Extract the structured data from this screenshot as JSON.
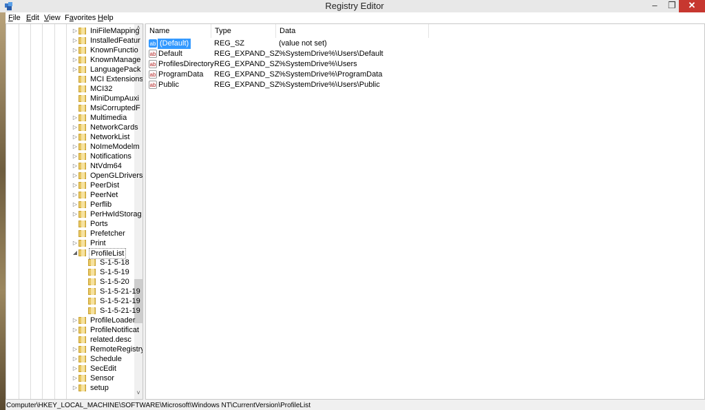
{
  "window": {
    "title": "Registry Editor",
    "minimize": "–",
    "maximize": "❐",
    "close": "✕",
    "app_icon": "regedit-icon"
  },
  "menu": [
    {
      "pre": "",
      "ul": "F",
      "post": "ile"
    },
    {
      "pre": "",
      "ul": "E",
      "post": "dit"
    },
    {
      "pre": "",
      "ul": "V",
      "post": "iew"
    },
    {
      "pre": "F",
      "ul": "a",
      "post": "vorites"
    },
    {
      "pre": "",
      "ul": "H",
      "post": "elp"
    }
  ],
  "tree": {
    "nodes": [
      {
        "label": "IniFileMapping",
        "expander": "▷"
      },
      {
        "label": "InstalledFeatur",
        "expander": "▷"
      },
      {
        "label": "KnownFunctio",
        "expander": "▷"
      },
      {
        "label": "KnownManage",
        "expander": "▷"
      },
      {
        "label": "LanguagePack",
        "expander": "▷"
      },
      {
        "label": "MCI Extensions",
        "expander": ""
      },
      {
        "label": "MCI32",
        "expander": ""
      },
      {
        "label": "MiniDumpAuxi",
        "expander": ""
      },
      {
        "label": "MsiCorruptedF",
        "expander": ""
      },
      {
        "label": "Multimedia",
        "expander": "▷"
      },
      {
        "label": "NetworkCards",
        "expander": "▷"
      },
      {
        "label": "NetworkList",
        "expander": "▷"
      },
      {
        "label": "NoImeModelm",
        "expander": "▷"
      },
      {
        "label": "Notifications",
        "expander": "▷"
      },
      {
        "label": "NtVdm64",
        "expander": "▷"
      },
      {
        "label": "OpenGLDrivers",
        "expander": "▷"
      },
      {
        "label": "PeerDist",
        "expander": "▷"
      },
      {
        "label": "PeerNet",
        "expander": "▷"
      },
      {
        "label": "Perflib",
        "expander": "▷"
      },
      {
        "label": "PerHwIdStorag",
        "expander": "▷"
      },
      {
        "label": "Ports",
        "expander": ""
      },
      {
        "label": "Prefetcher",
        "expander": ""
      },
      {
        "label": "Print",
        "expander": "▷"
      },
      {
        "label": "ProfileList",
        "expander": "◢",
        "selected": true
      },
      {
        "label": "S-1-5-18",
        "expander": "",
        "child": true
      },
      {
        "label": "S-1-5-19",
        "expander": "",
        "child": true
      },
      {
        "label": "S-1-5-20",
        "expander": "",
        "child": true
      },
      {
        "label": "S-1-5-21-19",
        "expander": "",
        "child": true
      },
      {
        "label": "S-1-5-21-19",
        "expander": "",
        "child": true
      },
      {
        "label": "S-1-5-21-19",
        "expander": "",
        "child": true
      },
      {
        "label": "ProfileLoader",
        "expander": "▷"
      },
      {
        "label": "ProfileNotificat",
        "expander": "▷"
      },
      {
        "label": "related.desc",
        "expander": ""
      },
      {
        "label": "RemoteRegistry",
        "expander": "▷"
      },
      {
        "label": "Schedule",
        "expander": "▷"
      },
      {
        "label": "SecEdit",
        "expander": "▷"
      },
      {
        "label": "Sensor",
        "expander": "▷"
      },
      {
        "label": "setup",
        "expander": "▷"
      }
    ]
  },
  "list": {
    "columns": [
      "Name",
      "Type",
      "Data"
    ],
    "rows": [
      {
        "name": "(Default)",
        "type": "REG_SZ",
        "data": "(value not set)",
        "icon": "ab",
        "selected": true
      },
      {
        "name": "Default",
        "type": "REG_EXPAND_SZ",
        "data": "%SystemDrive%\\Users\\Default",
        "icon": "ab"
      },
      {
        "name": "ProfilesDirectory",
        "type": "REG_EXPAND_SZ",
        "data": "%SystemDrive%\\Users",
        "icon": "ab"
      },
      {
        "name": "ProgramData",
        "type": "REG_EXPAND_SZ",
        "data": "%SystemDrive%\\ProgramData",
        "icon": "ab"
      },
      {
        "name": "Public",
        "type": "REG_EXPAND_SZ",
        "data": "%SystemDrive%\\Users\\Public",
        "icon": "ab"
      }
    ]
  },
  "status": {
    "path": "Computer\\HKEY_LOCAL_MACHINE\\SOFTWARE\\Microsoft\\Windows NT\\CurrentVersion\\ProfileList"
  },
  "colors": {
    "selection": "#3399ff",
    "close_button": "#c7372f",
    "folder": "#e8c760"
  }
}
